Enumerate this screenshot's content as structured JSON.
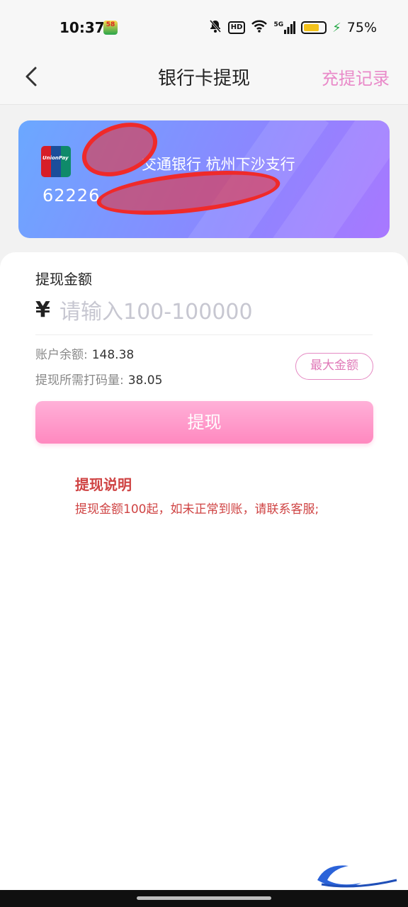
{
  "status_bar": {
    "time": "10:37",
    "app_badge": "58",
    "signal_label": "5G",
    "hd_label": "HD",
    "battery_percent": "75%",
    "battery_level": 0.75
  },
  "nav": {
    "title": "银行卡提现",
    "right_link": "充提记录"
  },
  "card": {
    "bank_name": "交通银行 杭州下沙支行",
    "card_number_visible": "62226",
    "logo_text": "UnionPay"
  },
  "form": {
    "amount_label": "提现金额",
    "currency_symbol": "¥",
    "amount_placeholder": "请输入100-100000",
    "balance_label": "账户余额:",
    "balance_value": "148.38",
    "wager_label": "提现所需打码量:",
    "wager_value": "38.05",
    "max_button": "最大金额",
    "submit_button": "提现"
  },
  "notice": {
    "title": "提现说明",
    "text": "提现金额100起，如未正常到账，请联系客服;"
  },
  "colors": {
    "accent_pink": "#ff88bf",
    "link_pink": "#e98ac9",
    "notice_red": "#cf4343",
    "card_blue": "#6ba8ff",
    "card_purple": "#a878ff"
  }
}
